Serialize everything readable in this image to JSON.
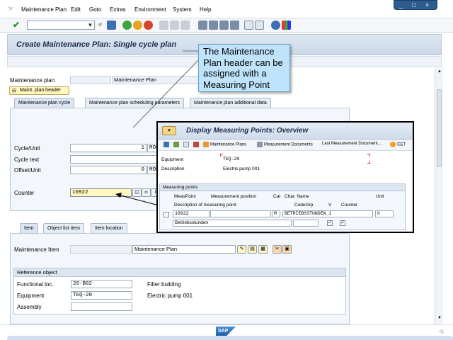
{
  "menubar": {
    "items": [
      "Maintenance Plan",
      "Edit",
      "Goto",
      "Extras",
      "Environment",
      "System",
      "Help"
    ]
  },
  "window_controls": {
    "minimize": "_",
    "restore": "□",
    "close": "×"
  },
  "toolbar": {
    "command_field": ""
  },
  "page": {
    "title": "Create Maintenance Plan: Single cycle plan"
  },
  "header": {
    "maintenance_plan_label": "Maintenance plan",
    "maintenance_plan_value": "",
    "maintenance_plan_desc": "Maintenance Plan",
    "maint_plan_header_button": "Maint. plan header"
  },
  "tabs": [
    "Maintenance plan cycle",
    "Maintenance plan scheduling parameters",
    "Maintenance plan additional data"
  ],
  "cycle": {
    "cycle_unit_label": "Cycle/Unit",
    "cycle_value": "1",
    "cycle_unit": "MON",
    "cycle_text_label": "Cycle text",
    "cycle_text_value": "",
    "offset_unit_label": "Offset/Unit",
    "offset_value": "0",
    "offset_unit": "MON",
    "counter_label": "Counter",
    "counter_value": "10922"
  },
  "item_tabs": [
    "Item",
    "Object list item",
    "Item location"
  ],
  "item": {
    "maintenance_item_label": "Maintenance Item",
    "maintenance_item_value": "",
    "maintenance_item_desc": "Maintenance Plan"
  },
  "reference_object": {
    "header": "Reference object",
    "functional_loc_label": "Functional loc.",
    "functional_loc_value": "20-B02",
    "functional_loc_desc": "Filter building",
    "equipment_label": "Equipment",
    "equipment_value": "TEQ-20",
    "equipment_desc": "Electric pump 001",
    "assembly_label": "Assembly",
    "assembly_value": ""
  },
  "callout": {
    "text": "The Maintenance Plan header can be assigned with a Measuring Point"
  },
  "popup": {
    "title": "Display Measuring Points: Overview",
    "toolbar": [
      "Maintenance Plans",
      "Measurement Documents",
      "Last Measurement Document...",
      "CET"
    ],
    "equipment_label": "Equipment",
    "equipment_value": "TEQ-20",
    "description_label": "Description",
    "description_value": "Electric pump 001",
    "measuring_points_header": "Measuring points",
    "columns_row1": [
      "MeasPoint",
      "Measurement position",
      "Cat",
      "Char. Name",
      "Unit"
    ],
    "columns_row2": [
      "Description of measuring point",
      "CodeGrp",
      "V",
      "Counter"
    ],
    "row": {
      "meas_point": "10922",
      "position": "",
      "cat": "M",
      "char_name": "BETRIEBSSTUNDEN_1",
      "unit": "h",
      "description": "Betriebsstunden",
      "code_grp": "",
      "v_checked": "✓",
      "counter_checked": "✓"
    }
  },
  "status": {
    "logo": "SAP"
  },
  "colors": {
    "callout_bg": "#bfe3fb",
    "highlight_field": "#fff7bd",
    "title_text": "#1c2f4d"
  }
}
